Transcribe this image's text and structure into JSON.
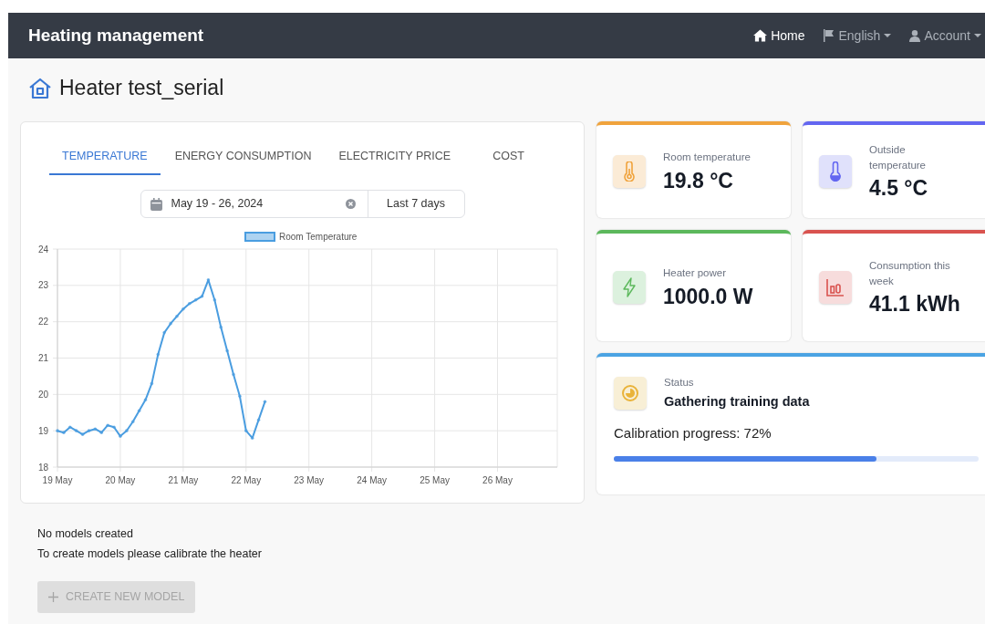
{
  "navbar": {
    "brand": "Heating management",
    "links": [
      {
        "label": "Home",
        "selected": true,
        "dropdown": false
      },
      {
        "label": "English",
        "selected": false,
        "dropdown": true
      },
      {
        "label": "Account",
        "selected": false,
        "dropdown": true
      }
    ]
  },
  "page_title": "Heater test_serial",
  "tabs": [
    {
      "label": "TEMPERATURE",
      "selected": true
    },
    {
      "label": "ENERGY CONSUMPTION",
      "selected": false
    },
    {
      "label": "ELECTRICITY PRICE",
      "selected": false
    },
    {
      "label": "COST",
      "selected": false
    }
  ],
  "date_range": {
    "value": "May 19 - 26, 2024",
    "preset_button": "Last 7 days"
  },
  "chart_data": {
    "type": "line",
    "categories": [
      "19 May",
      null,
      null,
      null,
      null,
      null,
      null,
      null,
      null,
      null,
      "20 May",
      null,
      null,
      null,
      null,
      null,
      null,
      null,
      null,
      null,
      "21 May",
      null,
      null,
      null,
      null,
      null,
      null,
      null,
      null,
      null,
      "22 May",
      null,
      null,
      null,
      null,
      null,
      null,
      null,
      null,
      null,
      "23 May",
      null,
      null,
      null,
      null,
      null,
      null,
      null,
      null,
      null,
      "24 May",
      null,
      null,
      null,
      null,
      null,
      null,
      null,
      null,
      null,
      "25 May",
      null,
      null,
      null,
      null,
      null,
      null,
      null,
      null,
      null,
      "26 May",
      null,
      null,
      null,
      null,
      null,
      null,
      null,
      null,
      null
    ],
    "grid": true,
    "series": [
      {
        "name": "Room Temperature",
        "color": "#4a9de0",
        "marker": true,
        "values": [
          19.0,
          18.95,
          19.1,
          19.0,
          18.9,
          19.0,
          19.05,
          18.95,
          19.15,
          19.1,
          18.85,
          19.0,
          19.25,
          19.55,
          19.85,
          20.3,
          21.1,
          21.7,
          21.95,
          22.15,
          22.35,
          22.5,
          22.6,
          22.7,
          23.15,
          22.6,
          21.85,
          21.2,
          20.55,
          19.95,
          19.0,
          18.8,
          19.3,
          19.8,
          null,
          null,
          null,
          null,
          null,
          null,
          null,
          null,
          null,
          null,
          null,
          null,
          null,
          null,
          null,
          null,
          null,
          null,
          null,
          null,
          null,
          null,
          null,
          null,
          null,
          null,
          null,
          null,
          null,
          null,
          null,
          null,
          null,
          null,
          null,
          null,
          null,
          null,
          null,
          null,
          null,
          null,
          null,
          null,
          null,
          null
        ]
      }
    ],
    "ylim": [
      18,
      24
    ],
    "yticks": [
      18,
      19,
      20,
      21,
      22,
      23,
      24
    ]
  },
  "stats": [
    {
      "label": "Room temperature",
      "value": "19.8 °C",
      "color": "#f0a33c"
    },
    {
      "label": "Outside temperature",
      "value": "4.5 °C",
      "color": "#6366f1"
    },
    {
      "label": "Heater power",
      "value": "1000.0 W",
      "color": "#5cb85c"
    },
    {
      "label": "Consumption this week",
      "value": "41.1 kWh",
      "color": "#d9534f"
    }
  ],
  "status": {
    "label": "Status",
    "value": "Gathering training data",
    "progress_text": "Calibration progress: 72%",
    "level": 0.72,
    "color": "#4ba3e3"
  },
  "models": {
    "message": "No models created",
    "hint": "To create models please calibrate the heater",
    "button": {
      "label": "CREATE NEW MODEL",
      "disabled": true
    }
  }
}
